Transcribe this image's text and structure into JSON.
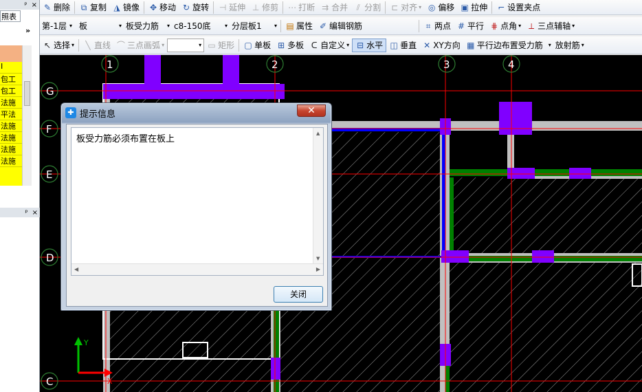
{
  "left_panel": {
    "tab_label": "照表",
    "pin_glyph": "ᵖ",
    "close_glyph": "×",
    "expand_glyph": "»",
    "items": [
      "I",
      "包工",
      "包工",
      "法施",
      "平法",
      "法施",
      "法施",
      "法施",
      "法施"
    ]
  },
  "toolbar1": {
    "delete": "删除",
    "copy": "复制",
    "mirror": "镜像",
    "move": "移动",
    "rotate": "旋转",
    "extend": "延伸",
    "trim": "修剪",
    "break": "打断",
    "merge": "合并",
    "split": "分割",
    "align": "对齐",
    "offset": "偏移",
    "stretch": "拉伸",
    "grip": "设置夹点"
  },
  "toolbar2": {
    "floor": "第-1层",
    "component_type": "板",
    "component": "板受力筋",
    "spec": "c8-150底",
    "layer": "分层板1",
    "properties": "属性",
    "edit_rebar": "编辑钢筋",
    "two_points": "两点",
    "parallel": "平行",
    "point_angle": "点角",
    "three_point_axis": "三点辅轴"
  },
  "toolbar3": {
    "select": "选择",
    "line": "直线",
    "arc": "三点画弧",
    "combo_value": "",
    "rect": "矩形",
    "single_board": "单板",
    "multi_board": "多板",
    "custom": "自定义",
    "horizontal": "水平",
    "vertical": "垂直",
    "xy_direction": "XY方向",
    "parallel_edge": "平行边布置受力筋",
    "radial": "放射筋"
  },
  "axes": {
    "vertical": [
      "1",
      "2",
      "3",
      "4"
    ],
    "horizontal": [
      "G",
      "F",
      "E",
      "D",
      "C"
    ],
    "ucs_x": "X",
    "ucs_y": "Y"
  },
  "dialog": {
    "title": "提示信息",
    "message": "板受力筋必须布置在板上",
    "close_button": "关闭"
  },
  "colors": {
    "canvas_bg": "#000000",
    "axis_line": "#ff0000",
    "wall_gray": "#c0c0c0",
    "column_purple": "#8000ff",
    "beam_green": "#008000",
    "beam_blue": "#0000ff"
  }
}
